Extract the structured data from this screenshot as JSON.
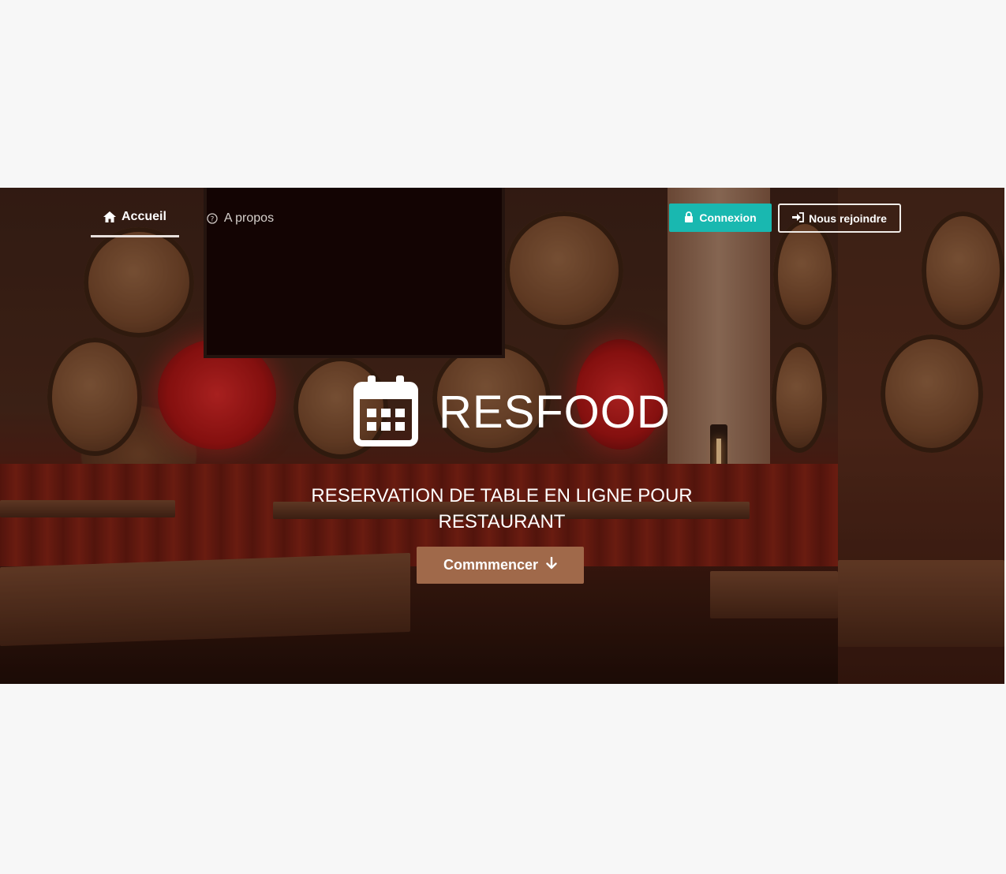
{
  "nav": {
    "home_label": "Accueil",
    "about_label": "A propos"
  },
  "auth": {
    "login_label": "Connexion",
    "join_label": "Nous rejoindre",
    "login_color": "#19b8b0"
  },
  "hero": {
    "brand": "RESFOOD",
    "tagline": "RESERVATION DE TABLE EN LIGNE POUR RESTAURANT",
    "cta_label": "Commmencer",
    "cta_color": "#a0694a"
  },
  "icons": {
    "home": "home-icon",
    "about": "question-circle-icon",
    "login": "lock-icon",
    "join": "sign-in-icon",
    "brand": "calendar-icon",
    "cta": "arrow-down-icon"
  }
}
